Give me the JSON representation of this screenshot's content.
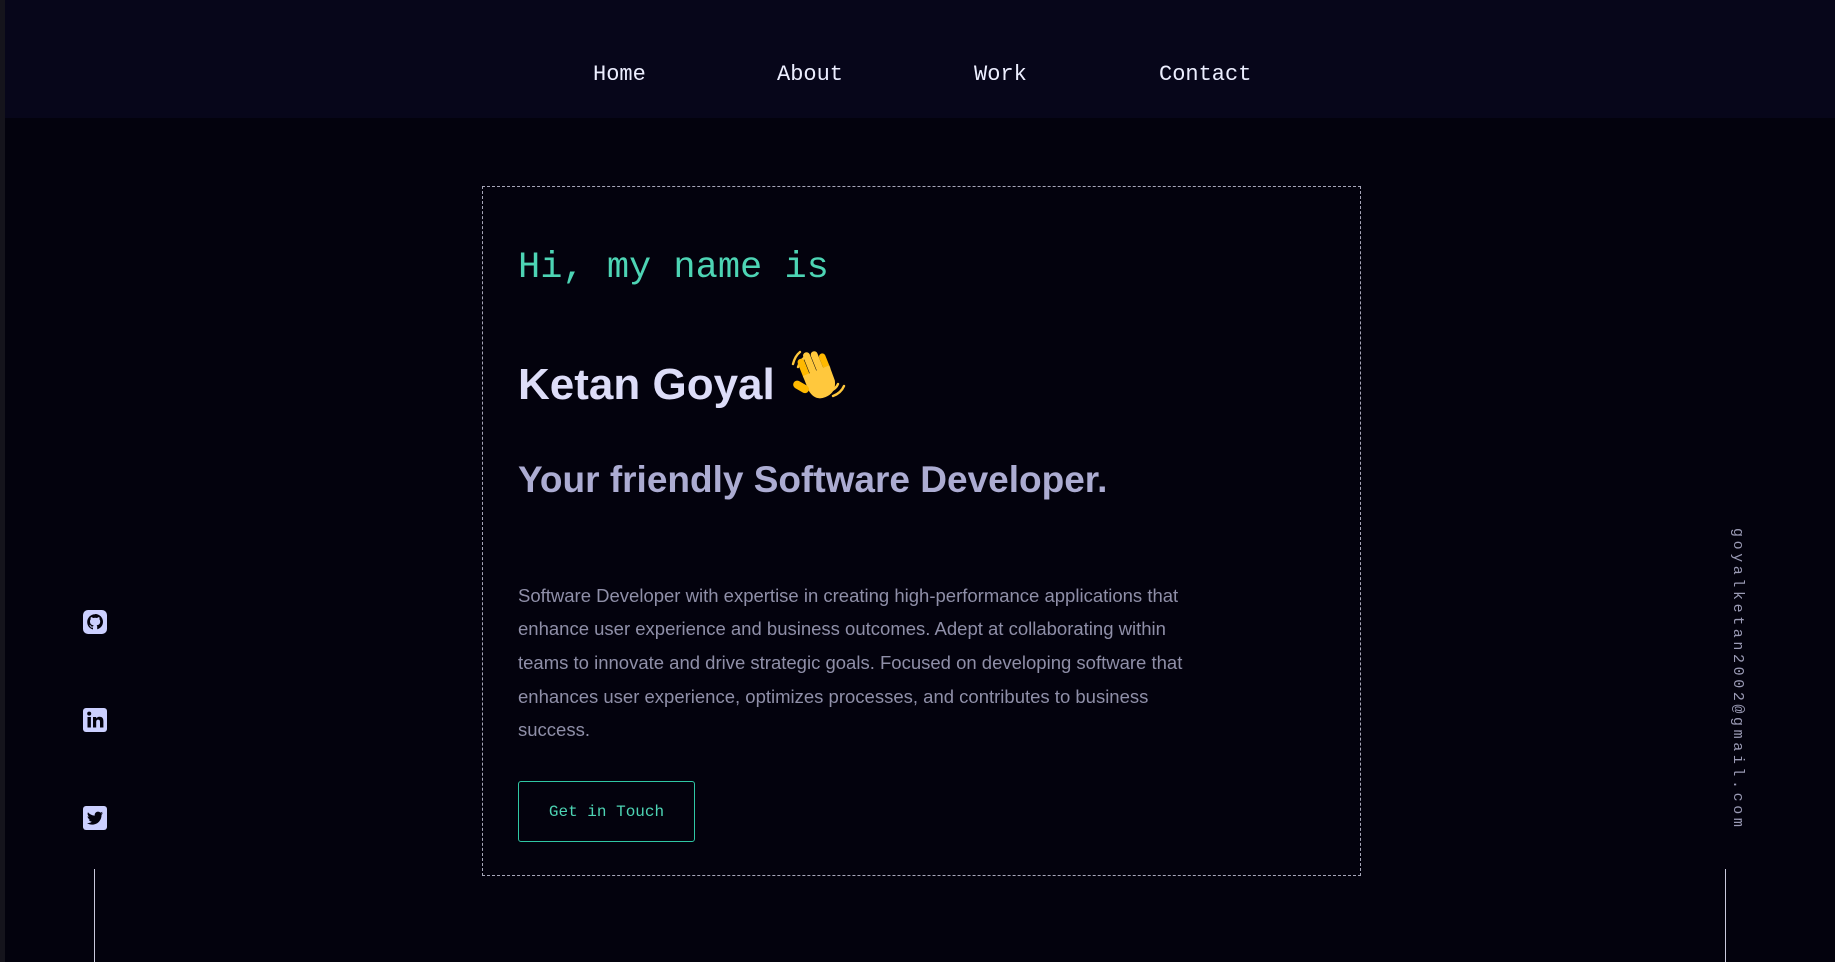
{
  "nav": {
    "home": "Home",
    "about": "About",
    "work": "Work",
    "contact": "Contact"
  },
  "hero": {
    "greeting": "Hi, my name is",
    "name": "Ketan Goyal",
    "tagline": "Your friendly Software Developer.",
    "bio": "Software Developer with expertise in creating high-performance applications that enhance user experience and business outcomes. Adept at collaborating within teams to innovate and drive strategic goals. Focused on developing software that enhances user experience, optimizes processes, and contributes to business success.",
    "cta_label": "Get in Touch"
  },
  "social": {
    "icons": [
      "github-icon",
      "linkedin-icon",
      "twitter-icon"
    ]
  },
  "email": "goyalketan2002@gmail.com",
  "colors": {
    "background": "#03020d",
    "navbar": "#07061a",
    "accent": "#4dd4b4",
    "heading": "#ddddf8",
    "subheading": "#acacd2",
    "body_text": "#8f8fa8"
  }
}
